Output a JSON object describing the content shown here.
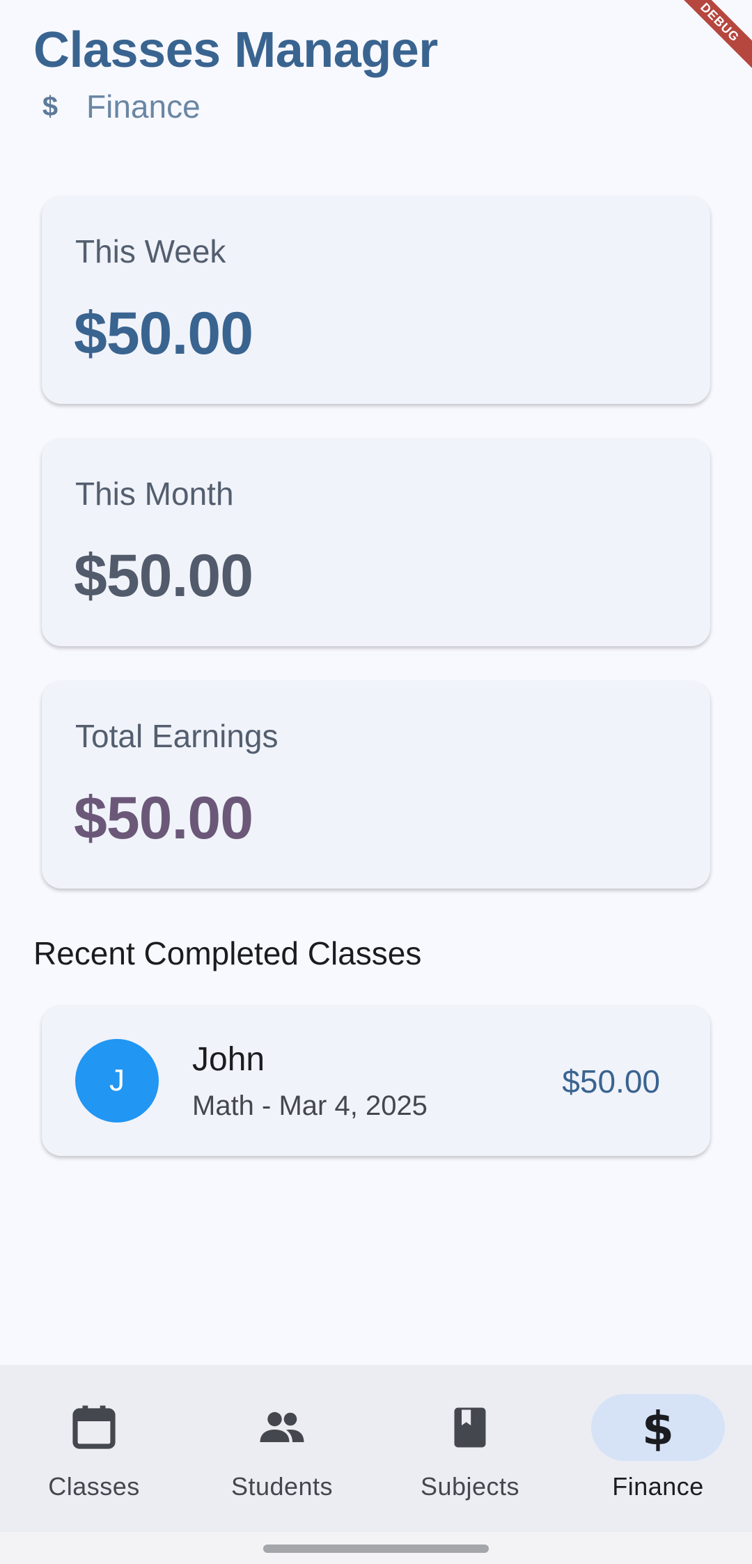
{
  "debug_banner": "DEBUG",
  "header": {
    "title": "Classes Manager",
    "subtitle_icon": "dollar-icon",
    "subtitle": "Finance"
  },
  "stats": {
    "week": {
      "label": "This Week",
      "amount": "$50.00",
      "color": "#3a6490"
    },
    "month": {
      "label": "This Month",
      "amount": "$50.00",
      "color": "#525b6b"
    },
    "total": {
      "label": "Total Earnings",
      "amount": "$50.00",
      "color": "#6b5878"
    }
  },
  "recent": {
    "title": "Recent Completed Classes",
    "items": [
      {
        "initial": "J",
        "name": "John",
        "detail": "Math - Mar 4, 2025",
        "amount": "$50.00",
        "avatar_color": "#2196f3"
      }
    ]
  },
  "nav": {
    "items": [
      {
        "label": "Classes",
        "icon": "calendar-icon",
        "active": false
      },
      {
        "label": "Students",
        "icon": "people-icon",
        "active": false
      },
      {
        "label": "Subjects",
        "icon": "book-icon",
        "active": false
      },
      {
        "label": "Finance",
        "icon": "dollar-icon",
        "active": true
      }
    ]
  },
  "colors": {
    "accent": "#3a6490",
    "background": "#f8f9ff",
    "card": "#f1f3fa",
    "nav_active_pill": "#d6e3f7"
  }
}
